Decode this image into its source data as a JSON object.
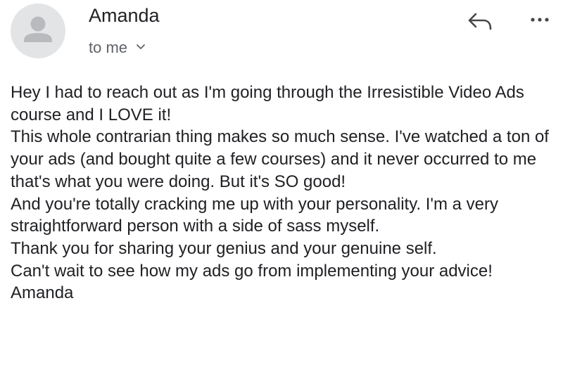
{
  "header": {
    "sender_name": "Amanda",
    "recipient_label": "to me",
    "avatar_icon": "person-icon",
    "reply_icon": "reply-icon",
    "more_icon": "more-horizontal-icon",
    "expand_icon": "chevron-down-icon"
  },
  "message": {
    "lines": [
      "Hey I had to reach out as I'm going through the Irresistible Video Ads course and I LOVE it!",
      "This whole contrarian thing makes so much sense.  I've watched a ton of your ads (and bought quite a few courses) and it never occurred to me that's what you were doing. But it's SO good!",
      "And you're totally cracking me up with your personality.  I'm a very straightforward person with a side of sass myself.",
      "Thank you for sharing your genius and your genuine self.",
      "Can't wait to see how my ads go from implementing your advice!",
      "Amanda"
    ]
  },
  "colors": {
    "avatar_bg": "#e3e4e6",
    "avatar_fg": "#b8babd",
    "text_primary": "#202124",
    "text_secondary": "#5f6368",
    "icon": "#444746"
  }
}
